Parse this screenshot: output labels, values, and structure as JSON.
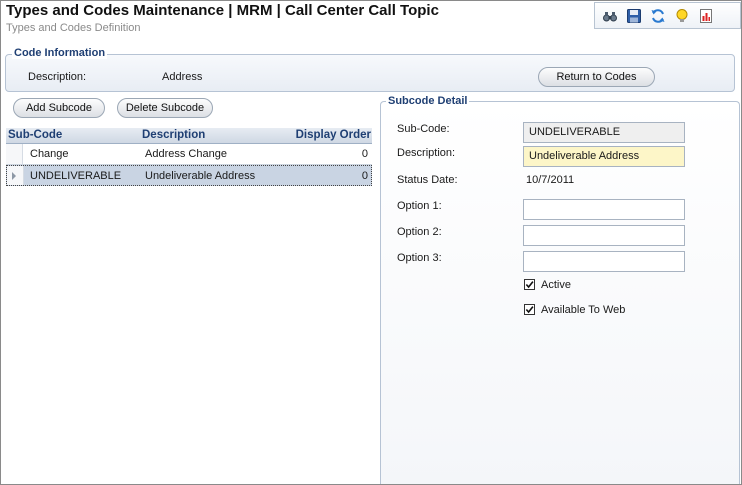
{
  "header": {
    "title": "Types and Codes Maintenance  |  MRM | Call Center Call Topic",
    "subtitle": "Types and Codes Definition"
  },
  "toolbar": {
    "icons": [
      "binoculars-icon",
      "save-icon",
      "refresh-icon",
      "lightbulb-icon",
      "report-icon"
    ]
  },
  "code_info": {
    "legend": "Code Information",
    "description_label": "Description:",
    "description_value": "Address",
    "return_button": "Return to Codes"
  },
  "subcode_actions": {
    "add": "Add Subcode",
    "delete": "Delete Subcode"
  },
  "grid": {
    "columns": [
      "Sub-Code",
      "Description",
      "Display Order"
    ],
    "rows": [
      {
        "code": "Change",
        "description": "Address Change",
        "order": "0"
      },
      {
        "code": "UNDELIVERABLE",
        "description": "Undeliverable Address",
        "order": "0"
      }
    ]
  },
  "detail": {
    "legend": "Subcode Detail",
    "subcode_label": "Sub-Code:",
    "subcode_value": "UNDELIVERABLE",
    "description_label": "Description:",
    "description_value": "Undeliverable Address",
    "status_date_label": "Status Date:",
    "status_date_value": "10/7/2011",
    "option1_label": "Option 1:",
    "option2_label": "Option 2:",
    "option3_label": "Option 3:",
    "option1_value": "",
    "option2_value": "",
    "option3_value": "",
    "active_label": "Active",
    "web_label": "Available To Web"
  },
  "colors": {
    "accent": "#1f3f73",
    "selected_row": "#c9d4e3",
    "required_field": "#fdf6c8"
  }
}
